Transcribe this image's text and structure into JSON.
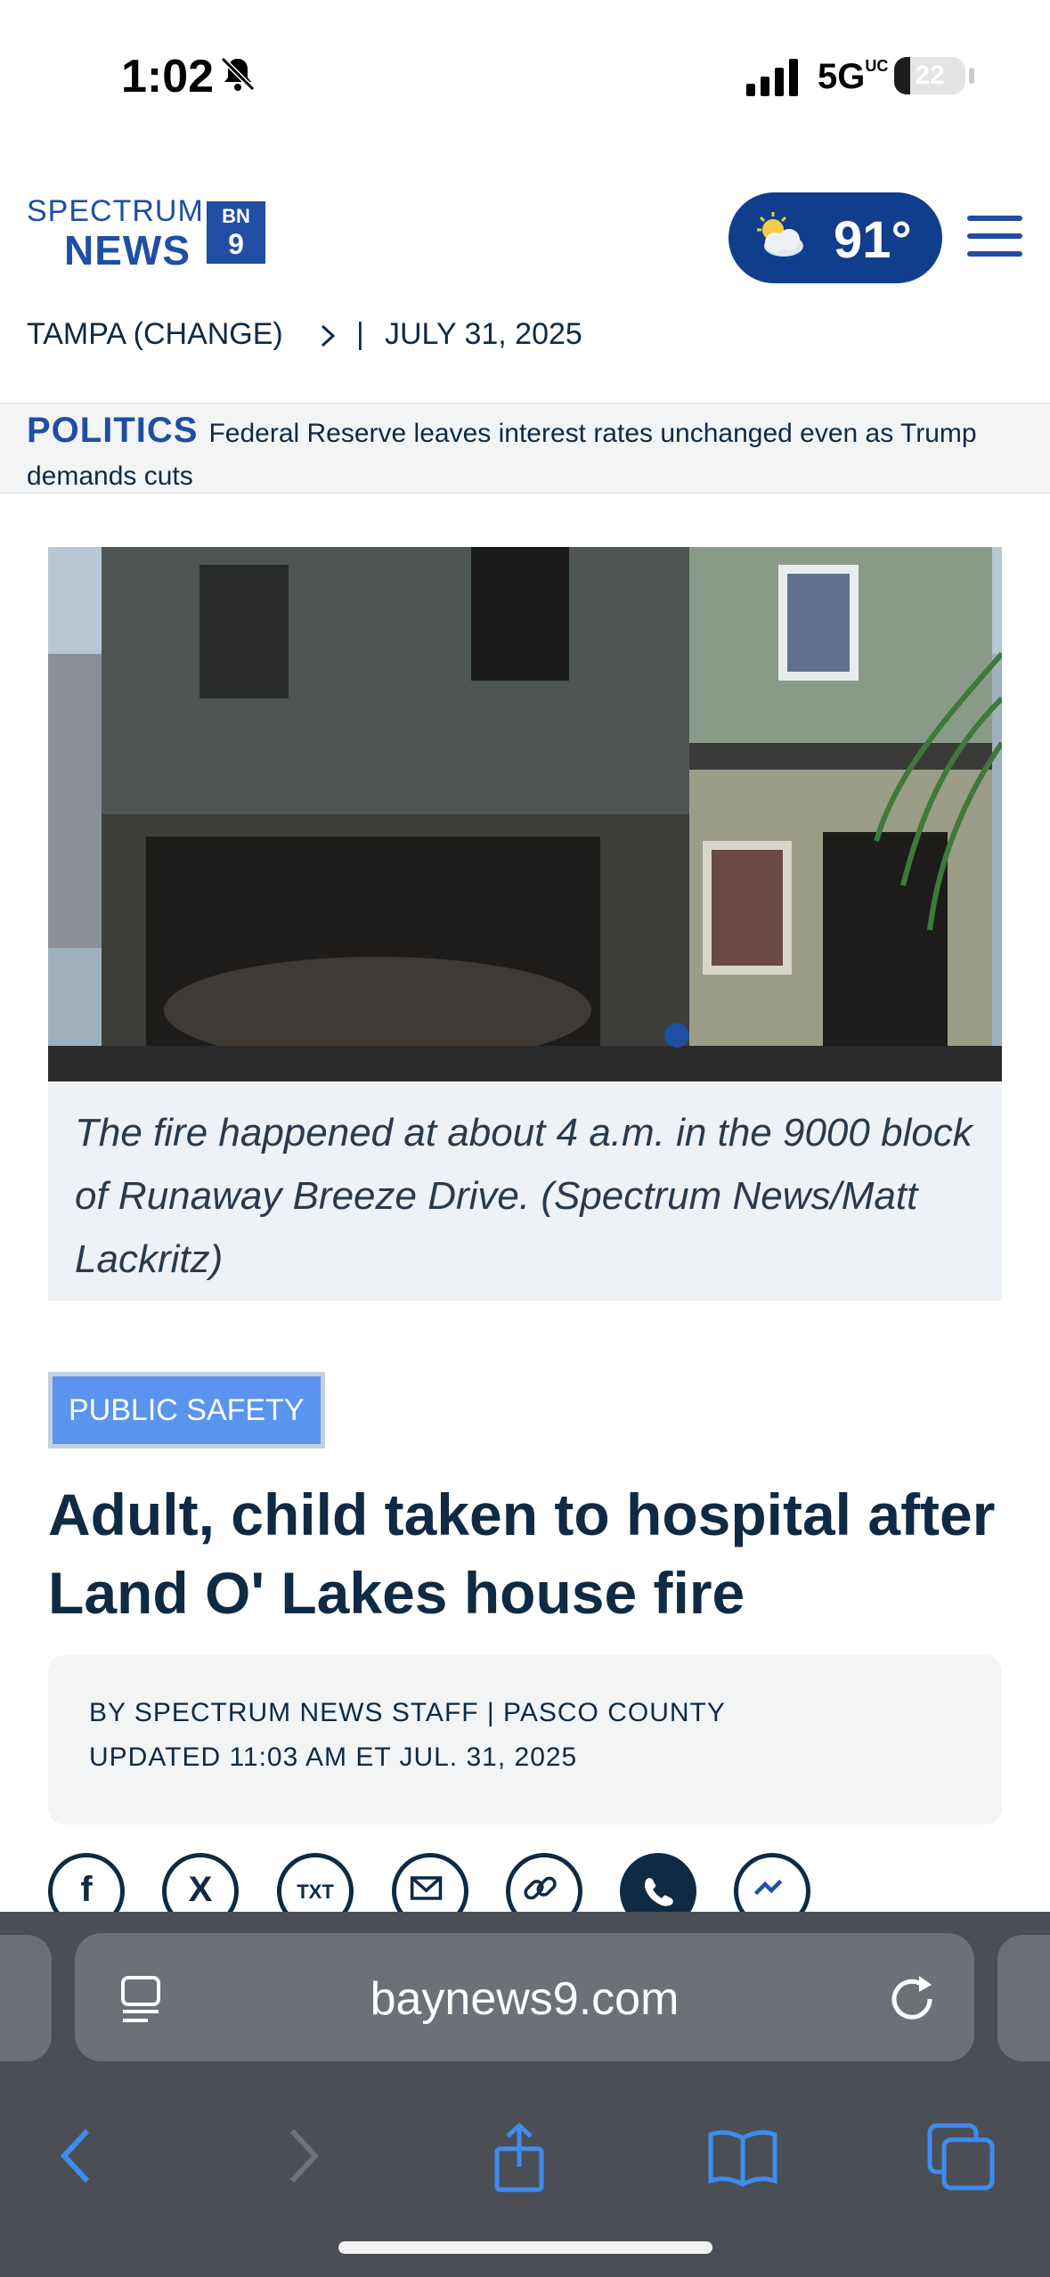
{
  "status_bar": {
    "time": "1:02",
    "network": "5G",
    "network_sup": "UC",
    "battery": "22",
    "battery_level": 0.22
  },
  "header": {
    "logo_line1": "SPECTRUM",
    "logo_line2": "NEWS",
    "logo_badge_top": "BN",
    "logo_badge_bottom": "9",
    "temperature": "91°"
  },
  "location": {
    "city": "TAMPA (CHANGE)",
    "separator": "|",
    "date": "JULY 31, 2025"
  },
  "breaking": {
    "kicker": "POLITICS",
    "text": "Federal Reserve leaves interest rates unchanged even as Trump demands cuts"
  },
  "article": {
    "caption": "The fire happened at about 4 a.m. in the 9000 block of Runaway Breeze Drive. (Spectrum News/Matt Lackritz)",
    "tag": "PUBLIC SAFETY",
    "headline": "Adult, child taken to hospital after Land O' Lakes house fire",
    "byline": "BY SPECTRUM NEWS STAFF | PASCO COUNTY",
    "updated": "UPDATED 11:03 AM ET JUL. 31, 2025"
  },
  "share": {
    "icons": [
      "facebook-icon",
      "x-icon",
      "text-message-icon",
      "email-icon",
      "link-icon",
      "whatsapp-icon",
      "messenger-icon"
    ],
    "facebook": "f",
    "x": "X",
    "txt": "TXT"
  },
  "browser": {
    "url": "baynews9.com"
  },
  "colors": {
    "brand_blue": "#1f4ea3",
    "weather_pill": "#103e8c",
    "tag_blue": "#5b94ee",
    "headline": "#0f2a44"
  }
}
